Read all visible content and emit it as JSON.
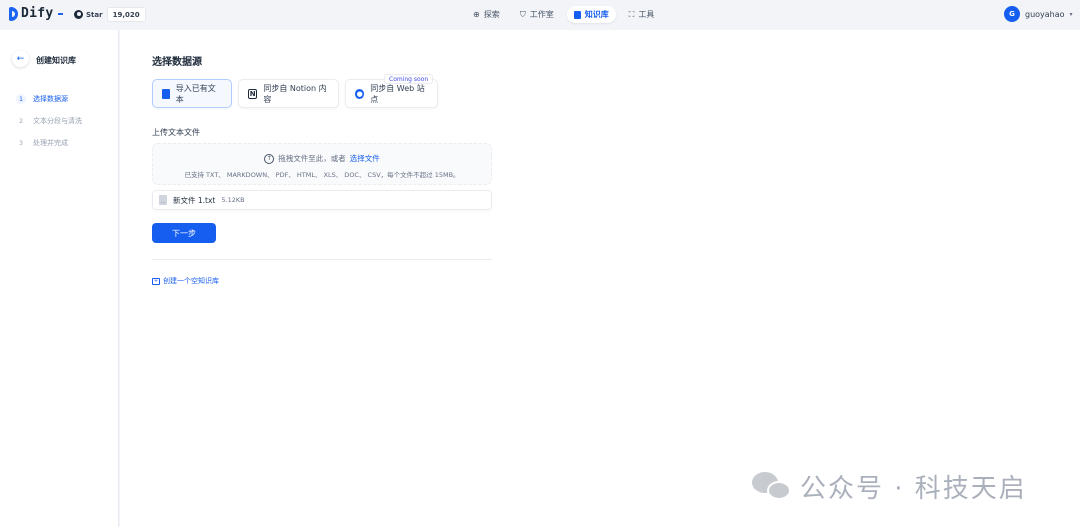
{
  "header": {
    "logo": "Dify",
    "github": {
      "star_label": "Star",
      "count": "19,020"
    },
    "nav": [
      {
        "label": "探索",
        "icon": "compass-icon"
      },
      {
        "label": "工作室",
        "icon": "shield-icon"
      },
      {
        "label": "知识库",
        "icon": "book-icon",
        "active": true
      },
      {
        "label": "工具",
        "icon": "toolbox-icon"
      }
    ],
    "user": {
      "initial": "G",
      "name": "guoyahao"
    }
  },
  "sidebar": {
    "title": "创建知识库",
    "steps": [
      {
        "num": "1",
        "label": "选择数据源",
        "active": true
      },
      {
        "num": "2",
        "label": "文本分段与清洗"
      },
      {
        "num": "3",
        "label": "处理并完成"
      }
    ]
  },
  "main": {
    "section_title": "选择数据源",
    "sources": [
      {
        "label": "导入已有文本",
        "active": true
      },
      {
        "label": "同步自 Notion 内容"
      },
      {
        "label": "同步自 Web 站点"
      }
    ],
    "coming_soon": "Coming soon",
    "upload_label": "上传文本文件",
    "drop_text": "拖拽文件至此，或者",
    "drop_link": "选择文件",
    "drop_hint": "已支持 TXT、 MARKDOWN、 PDF、 HTML、 XLS、 DOC、 CSV，每个文件不超过 15MB。",
    "file": {
      "ext": "txt",
      "name": "新文件 1.txt",
      "size": "5.12KB"
    },
    "next_button": "下一步",
    "create_empty": "创建一个空知识库"
  },
  "watermark": "公众号 · 科技天启",
  "colors": {
    "accent": "#155eef",
    "sidebar_bg": "#ffffff",
    "page_bg": "#f2f4f7"
  }
}
